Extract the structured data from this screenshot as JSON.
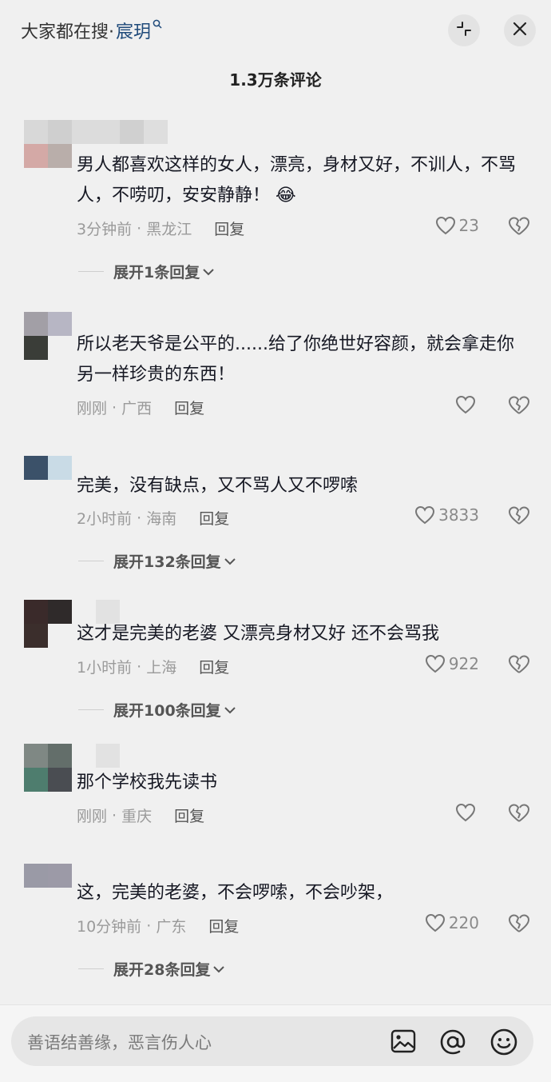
{
  "header": {
    "search_prefix": "大家都在搜·",
    "search_keyword": "宸玥",
    "search_icon": "search-icon",
    "collapse_icon": "collapse-icon",
    "close_icon": "close-icon"
  },
  "comment_count_title": "1.3万条评论",
  "colors": {
    "accent": "#1f4a7a",
    "text": "#161823",
    "muted": "#9a9a9a"
  },
  "comments": [
    {
      "text": "男人都喜欢这样的女人，漂亮，身材又好，不训人，不骂人，不唠叨，安安静静！",
      "emoji": "😂",
      "time": "3分钟前",
      "location": "黑龙江",
      "reply_label": "回复",
      "likes": "23",
      "expand_label": "展开1条回复"
    },
    {
      "text": "所以老天爷是公平的......给了你绝世好容颜，就会拿走你另一样珍贵的东西！",
      "time": "刚刚",
      "location": "广西",
      "reply_label": "回复",
      "likes": ""
    },
    {
      "text": "完美，没有缺点，又不骂人又不啰嗦",
      "time": "2小时前",
      "location": "海南",
      "reply_label": "回复",
      "likes": "3833",
      "expand_label": "展开132条回复"
    },
    {
      "text": "这才是完美的老婆 又漂亮身材又好 还不会骂我",
      "time": "1小时前",
      "location": "上海",
      "reply_label": "回复",
      "likes": "922",
      "expand_label": "展开100条回复"
    },
    {
      "text": "那个学校我先读书",
      "time": "刚刚",
      "location": "重庆",
      "reply_label": "回复",
      "likes": ""
    },
    {
      "text": "这，完美的老婆，不会啰嗦，不会吵架，",
      "time": "10分钟前",
      "location": "广东",
      "reply_label": "回复",
      "likes": "220",
      "expand_label": "展开28条回复"
    }
  ],
  "input": {
    "placeholder": "善语结善缘，恶言伤人心",
    "image_icon": "image-icon",
    "at_icon": "at-icon",
    "emoji_icon": "emoji-icon"
  }
}
